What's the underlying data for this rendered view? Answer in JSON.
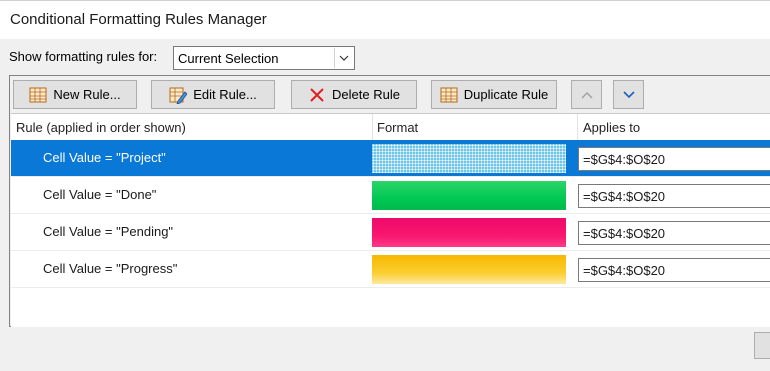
{
  "window": {
    "title": "Conditional Formatting Rules Manager"
  },
  "filter": {
    "label": "Show formatting rules for:",
    "value": "Current Selection"
  },
  "toolbar": {
    "new_rule": "New Rule...",
    "edit_rule": "Edit Rule...",
    "delete_rule": "Delete Rule",
    "duplicate_rule": "Duplicate Rule"
  },
  "columns": {
    "rule": "Rule (applied in order shown)",
    "format": "Format",
    "applies_to": "Applies to"
  },
  "rules": [
    {
      "name": "Cell Value = \"Project\"",
      "applies_to": "=$G$4:$O$20",
      "color": "#4fb6e0",
      "selected": true
    },
    {
      "name": "Cell Value = \"Done\"",
      "applies_to": "=$G$4:$O$20",
      "color": "#00c853",
      "selected": false
    },
    {
      "name": "Cell Value = \"Pending\"",
      "applies_to": "=$G$4:$O$20",
      "color": "#f5146f",
      "selected": false
    },
    {
      "name": "Cell Value = \"Progress\"",
      "applies_to": "=$G$4:$O$20",
      "color": "#f8c21c",
      "selected": false
    }
  ],
  "colors": {
    "selection": "#0a78d7"
  }
}
